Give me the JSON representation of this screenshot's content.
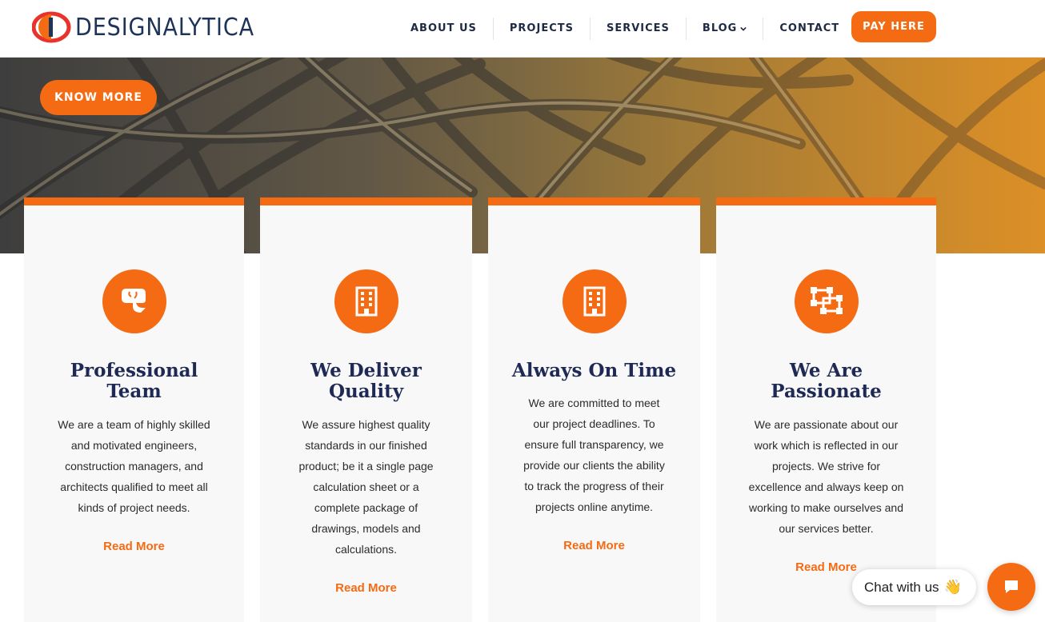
{
  "brand": {
    "name": "DESIGNALYTICA",
    "accent_color": "#f46b14",
    "navy_color": "#1e2a55"
  },
  "nav": {
    "items": [
      {
        "label": "ABOUT US"
      },
      {
        "label": "PROJECTS"
      },
      {
        "label": "SERVICES"
      },
      {
        "label": "BLOG",
        "icon": "chevron-down-icon"
      },
      {
        "label": "CONTACT"
      }
    ],
    "pay_label": "PAY HERE"
  },
  "hero": {
    "button_label": "KNOW MORE"
  },
  "cards": [
    {
      "icon": "head-brain-icon",
      "title_line1": "Professional",
      "title_line2": "Team",
      "desc": [
        "We are a team of highly skilled",
        "and motivated engineers,",
        "construction managers, and",
        "architects qualified to meet all",
        "kinds of project needs."
      ],
      "link": "Read More"
    },
    {
      "icon": "building-icon",
      "title_line1": "We Deliver",
      "title_line2": "Quality",
      "desc": [
        "We assure highest quality",
        "standards in our finished",
        "product; be it a single page",
        "calculation sheet or a",
        "complete package of",
        "drawings, models and",
        "calculations."
      ],
      "link": "Read More"
    },
    {
      "icon": "building-icon",
      "title_line1": "Always On Time",
      "title_line2": "",
      "desc": [
        "We are committed to meet",
        "our project deadlines. To",
        "ensure full transparency, we",
        "provide our clients the ability",
        "to track the progress of their",
        "projects online anytime."
      ],
      "link": "Read More"
    },
    {
      "icon": "object-group-icon",
      "title_line1": "We Are",
      "title_line2": "Passionate",
      "desc": [
        "We are passionate about our",
        "work which is reflected in our",
        "projects. We strive for",
        "excellence and always keep on",
        "working to make ourselves and",
        "our services better."
      ],
      "link": "Read More"
    }
  ],
  "chat": {
    "label": "Chat with us",
    "emoji": "👋",
    "icon": "chat-bubble-icon"
  }
}
